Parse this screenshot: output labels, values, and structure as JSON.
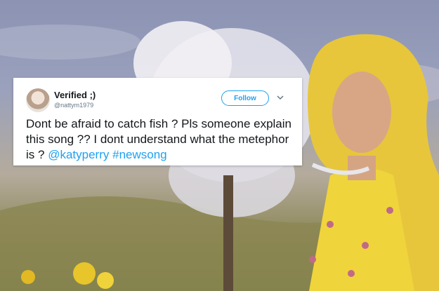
{
  "tweet": {
    "display_name": "Verified ;)",
    "handle": "@nattym1979",
    "follow_label": "Follow",
    "text": "Dont be afraid to catch fish ? Pls someone explain this song ?? I dont understand what the metephor is ?",
    "mention": "@katyperry",
    "hashtag": "#newsong",
    "accent_color": "#1da1f2"
  },
  "icons": {
    "avatar": "profile-photo",
    "menu": "chevron-down-icon"
  }
}
